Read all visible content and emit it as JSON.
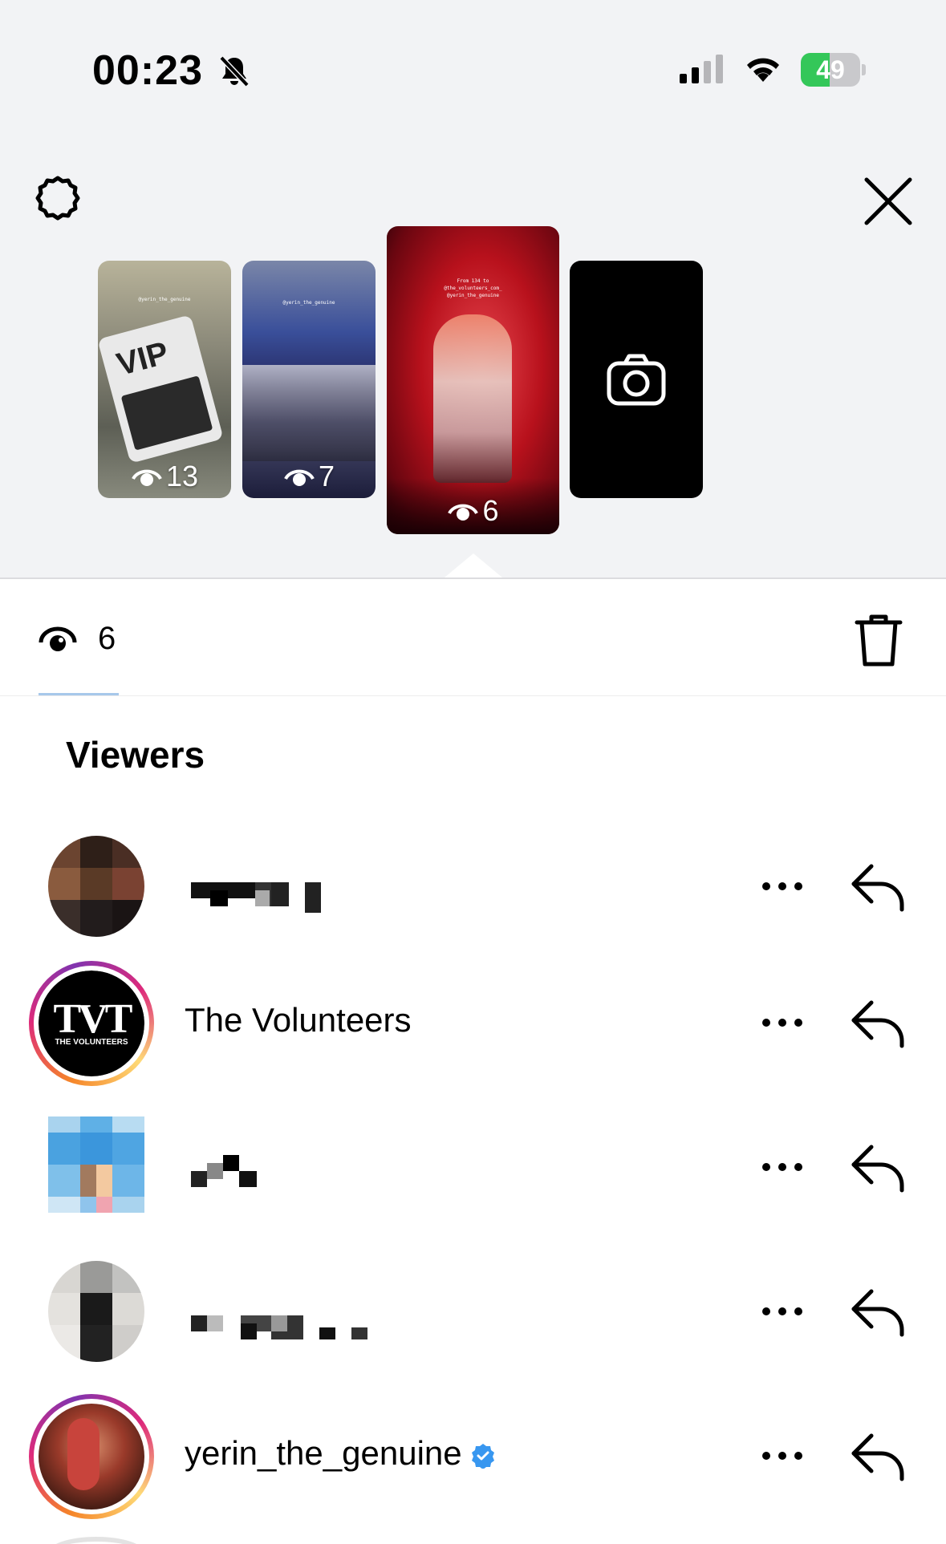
{
  "status_bar": {
    "time": "00:23",
    "battery_text": "49",
    "battery_level": 0.49,
    "battery_color": "#34c759"
  },
  "header": {
    "settings_icon": "gear-icon",
    "close_icon": "close-icon"
  },
  "stories": [
    {
      "views": "13",
      "caption": "@yerin_the_genuine"
    },
    {
      "views": "7",
      "caption": "@yerin_the_genuine"
    },
    {
      "views": "6",
      "caption": "From 134 to\n@the_volunteers_com_\n@yerin_the_genuine",
      "selected": true
    },
    {
      "icon": "camera-icon"
    }
  ],
  "vip_text": "VIP",
  "tab": {
    "views_count": "6",
    "icon": "eye-icon",
    "delete_icon": "trash-icon"
  },
  "viewers": {
    "title": "Viewers",
    "list": [
      {
        "name": "",
        "pixelated": true
      },
      {
        "name": "The Volunteers",
        "story_ring": true,
        "logo_big": "TVT",
        "logo_small": "THE VOLUNTEERS"
      },
      {
        "name": "",
        "pixelated": true
      },
      {
        "name": "",
        "pixelated": true
      },
      {
        "name": "yerin_the_genuine",
        "story_ring": true,
        "verified": true
      }
    ]
  },
  "colors": {
    "accent_blue": "#3897f0",
    "top_background": "#f2f3f5"
  }
}
